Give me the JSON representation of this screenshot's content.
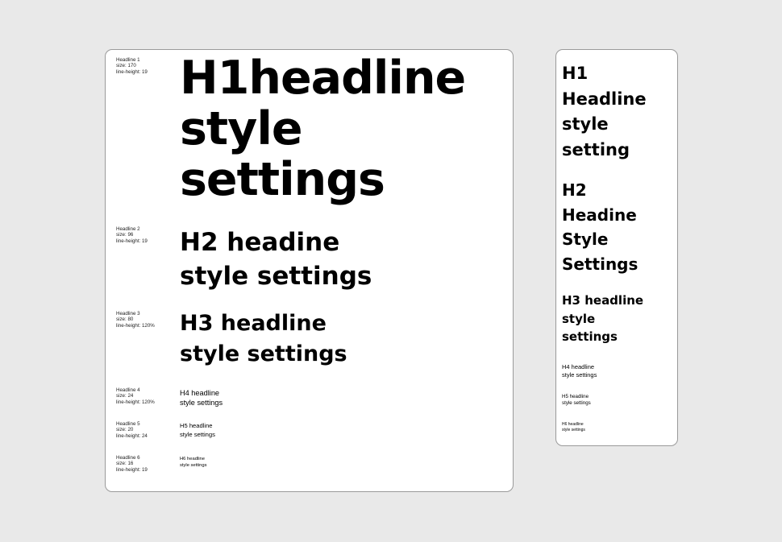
{
  "desktop": {
    "specs": [
      {
        "name": "Headline 1",
        "size": "size: 170",
        "line_height": "line-height: 19"
      },
      {
        "name": "Headline 2",
        "size": "size: 96",
        "line_height": "line-height: 19"
      },
      {
        "name": "Headline 3",
        "size": "size: 80",
        "line_height": "line-height: 120%"
      },
      {
        "name": "Headline 4",
        "size": "size: 24",
        "line_height": "line-height: 120%"
      },
      {
        "name": "Headline 5",
        "size": "size: 20",
        "line_height": "line-height: 24"
      },
      {
        "name": "Headline 6",
        "size": "size: 16",
        "line_height": "line-height: 19"
      }
    ],
    "samples": {
      "h1": [
        "H1headline",
        "style",
        "settings"
      ],
      "h2": [
        "H2 headine",
        "style settings"
      ],
      "h3": [
        "H3 headline",
        "style settings"
      ],
      "h4": [
        "H4 headline",
        "style settings"
      ],
      "h5": [
        "H5 headline",
        "style settings"
      ],
      "h6": [
        "H6 headline",
        "style settings"
      ]
    }
  },
  "mobile": {
    "samples": {
      "h1": [
        "H1",
        "Headline",
        "style",
        "setting"
      ],
      "h2": [
        "H2",
        "Headine",
        "Style",
        "Settings"
      ],
      "h3": [
        "H3 headline",
        "style",
        "settings"
      ],
      "h4": [
        "H4 headline",
        "style settings"
      ],
      "h5": [
        "H5 headline",
        "style settings"
      ],
      "h6": [
        "H6 headline",
        "style settings"
      ]
    }
  },
  "colors": {
    "background": "#e9e9e9",
    "card": "#ffffff",
    "card_border": "#9a9a9a",
    "text": "#000000"
  }
}
